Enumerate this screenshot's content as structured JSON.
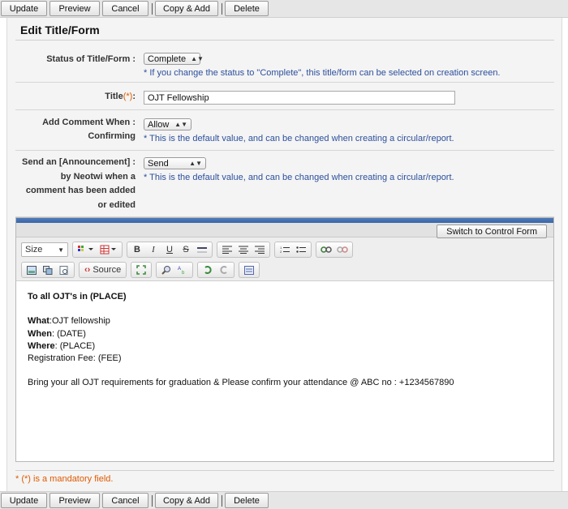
{
  "actions": {
    "update": "Update",
    "preview": "Preview",
    "cancel": "Cancel",
    "copy_add": "Copy & Add",
    "delete": "Delete"
  },
  "page_title": "Edit Title/Form",
  "status": {
    "label": "Status of Title/Form :",
    "value": "Complete",
    "hint": "* If you change the status to \"Complete\", this title/form can be selected on creation screen."
  },
  "title_field": {
    "label": "Title",
    "required_mark": "(*)",
    "colon": ":",
    "value": "OJT Fellowship"
  },
  "add_comment": {
    "label_line1": "Add Comment When :",
    "label_line2": "Confirming",
    "value": "Allow",
    "hint": "* This is the default value, and can be changed when creating a circular/report."
  },
  "announcement": {
    "label_line1": "Send an [Announcement] :",
    "label_line2": "by Neotwi when a",
    "label_line3": "comment has been added",
    "label_line4": "or edited",
    "value": "Send",
    "hint": "* This is the default value, and can be changed when creating a circular/report."
  },
  "editor": {
    "switch_label": "Switch to Control Form",
    "size_label": "Size",
    "source_label": "Source",
    "content": {
      "greeting": "To all OJT's in (PLACE)",
      "what_label": "What",
      "what_value": ":OJT fellowship",
      "when_label": "When",
      "when_value": ": (DATE)",
      "where_label": "Where",
      "where_value": ": (PLACE)",
      "fee": "Registration Fee: (FEE)",
      "closing": "Bring your all OJT requirements for graduation & Please confirm your attendance @ ABC no : +1234567890"
    }
  },
  "footer_note": "* (*) is a mandatory field."
}
